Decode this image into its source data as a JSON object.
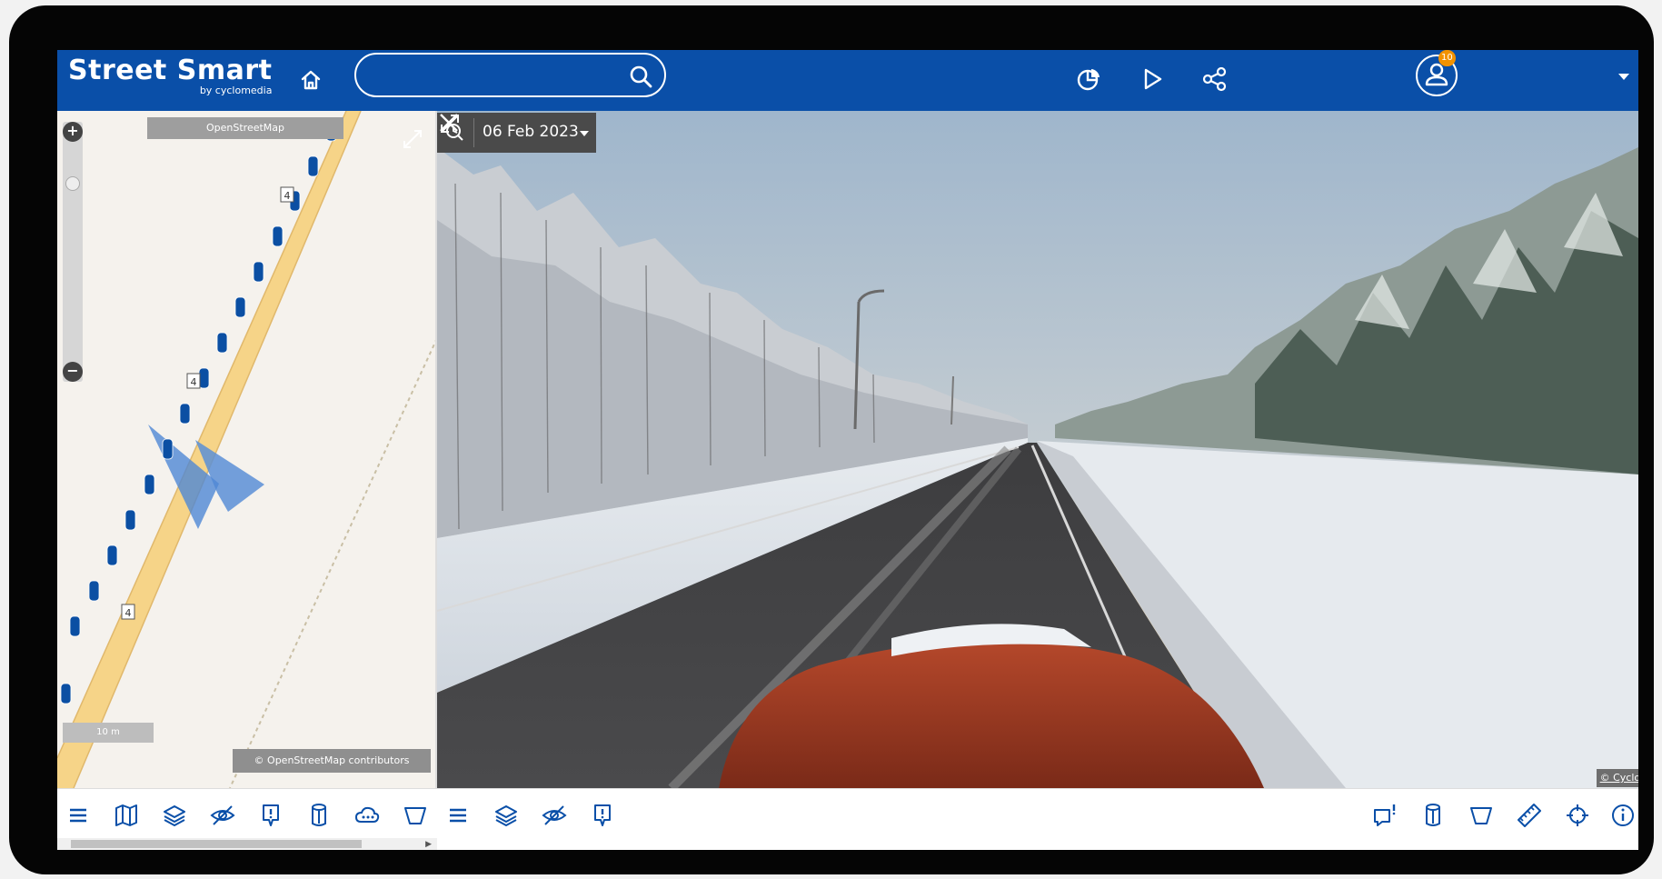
{
  "app": {
    "title": "Street Smart",
    "subtitle": "by cyclomedia"
  },
  "search": {
    "value": "",
    "placeholder": ""
  },
  "header": {
    "icons": [
      "home-icon",
      "search-icon",
      "coverage-icon",
      "play-icon",
      "share-icon",
      "user-icon"
    ],
    "notification_count": "10"
  },
  "map": {
    "basemap_label": "OpenStreetMap",
    "scale_label": "10 m",
    "attribution": "© OpenStreetMap contributors",
    "zoom_in": "+",
    "zoom_out": "−",
    "road_labels": [
      "4",
      "4",
      "4"
    ]
  },
  "map_toolbar": {
    "icons": [
      "menu-icon",
      "map-icon",
      "layers-icon",
      "visibility-icon",
      "report-icon",
      "cylinder-icon",
      "cloud-icon",
      "area-icon"
    ]
  },
  "panorama": {
    "date": "06 Feb 2023",
    "attribution": "© Cyclomedia"
  },
  "pano_toolbar": {
    "left_icons": [
      "menu-icon",
      "layers-icon",
      "visibility-icon",
      "report-icon"
    ],
    "right_icons": [
      "comment-alert-icon",
      "cylinder-icon",
      "area-icon",
      "ruler-icon",
      "crosshair-icon",
      "info-icon"
    ]
  },
  "colors": {
    "brand_blue": "#0a4fa8",
    "badge_orange": "#f39200",
    "road_yellow": "#f6d488",
    "marker_blue": "#0b4fa3",
    "viewcone_blue": "#5b8fd6"
  }
}
